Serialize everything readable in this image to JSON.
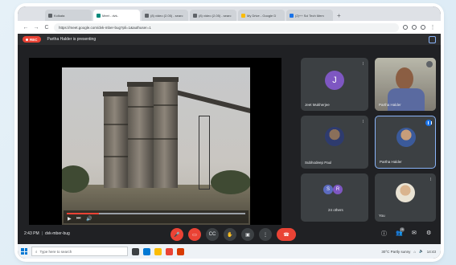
{
  "browser": {
    "tabs": [
      {
        "label": "Kolkata",
        "icon": "generic"
      },
      {
        "label": "Meet - dvk-",
        "icon": "meet"
      },
      {
        "label": "(8) video (2.05) - searc",
        "icon": "generic"
      },
      {
        "label": "(8) video (2.05) - searc",
        "icon": "generic"
      },
      {
        "label": "My Drive - Google D",
        "icon": "drive"
      },
      {
        "label": "(2)++ Sci Tech Mem",
        "icon": "blue"
      }
    ],
    "new_tab": "+",
    "url": "https://meet.google.com/dvk-mber-bug?pli=1&authuser=1",
    "nav": {
      "back": "←",
      "forward": "→",
      "reload": "C"
    }
  },
  "meet": {
    "rec_label": "REC",
    "presenting_text": "Partha Halder is presenting",
    "time": "2:43 PM",
    "meeting_code": "dvk-mber-bug",
    "participants": [
      {
        "name": "Jeet Mukherjee",
        "initial": "J",
        "avatar_color": "#7e57c2",
        "type": "letter"
      },
      {
        "name": "Partha Halder",
        "type": "video"
      },
      {
        "name": "Subhodeep Paul",
        "type": "photo"
      },
      {
        "name": "Partha Halder",
        "type": "photo",
        "active": true
      },
      {
        "name": "24 others",
        "type": "group",
        "initials": [
          "S",
          "R"
        ]
      },
      {
        "name": "You",
        "type": "photo"
      }
    ],
    "controls": [
      {
        "name": "mic-off",
        "glyph": "🎤"
      },
      {
        "name": "camera-off",
        "glyph": "▭"
      },
      {
        "name": "captions",
        "glyph": "CC"
      },
      {
        "name": "raise-hand",
        "glyph": "✋"
      },
      {
        "name": "present",
        "glyph": "▣"
      },
      {
        "name": "more",
        "glyph": "⋮"
      },
      {
        "name": "leave",
        "glyph": "☎"
      }
    ],
    "right_icons": [
      {
        "name": "info",
        "glyph": "ⓘ"
      },
      {
        "name": "people",
        "glyph": "👥",
        "badge": "28"
      },
      {
        "name": "chat",
        "glyph": "✉"
      },
      {
        "name": "activities",
        "glyph": "⚙"
      }
    ],
    "player": {
      "play": "▶",
      "next": "⏭",
      "volume": "🔊",
      "progress": 0.18
    }
  },
  "taskbar": {
    "search_placeholder": "Type here to search",
    "weather": "30°C Partly sunny",
    "clock": "14:43"
  }
}
